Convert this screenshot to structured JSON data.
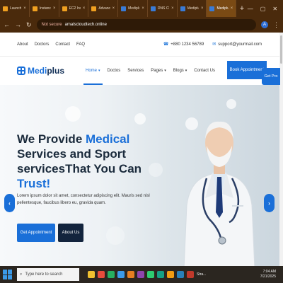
{
  "browser": {
    "tabs": [
      {
        "label": "Launch ..",
        "color": "#f0a020"
      },
      {
        "label": "Instanc..",
        "color": "#f0a020"
      },
      {
        "label": "EC2 Insta..",
        "color": "#f0a020"
      },
      {
        "label": "Advance..",
        "color": "#f0a020"
      },
      {
        "label": "Mediplus",
        "color": "#3a7bd5"
      },
      {
        "label": "DNS Che..",
        "color": "#3a7bd5"
      },
      {
        "label": "Mediplus",
        "color": "#3a7bd5"
      },
      {
        "label": "Mediplus",
        "color": "#3a7bd5",
        "active": true
      }
    ],
    "new_tab": "+",
    "controls": {
      "minimize": "—",
      "maximize": "▢",
      "close": "✕"
    },
    "address": {
      "not_secure": "Not secure",
      "url": "amalscloudtech.online"
    },
    "profile_initial": "A"
  },
  "topbar": {
    "links": [
      "About",
      "Doctors",
      "Contact",
      "FAQ"
    ],
    "phone": "+880 1234 56789",
    "email": "support@yourmail.com"
  },
  "nav": {
    "logo_prefix": "Medi",
    "logo_suffix": "plus",
    "items": [
      {
        "label": "Home",
        "caret": true,
        "active": true
      },
      {
        "label": "Doctos",
        "caret": false
      },
      {
        "label": "Services",
        "caret": false
      },
      {
        "label": "Pages",
        "caret": true
      },
      {
        "label": "Blogs",
        "caret": true
      },
      {
        "label": "Contact Us",
        "caret": false
      }
    ],
    "book_button": "Book Appointment",
    "get_pro": "Get Pro"
  },
  "hero": {
    "headline_1": "We Provide ",
    "headline_2": "Medical",
    "headline_3": " Services and Sport servicesThat You Can ",
    "headline_4": "Trust!",
    "paragraph": "Lorem ipsum dolor sit amet, consectetur adipiscing elit. Mauris sed nisl pellentesque, faucibus libero eu, gravida quam.",
    "primary_button": "Get Appointment",
    "secondary_button": "About Us",
    "prev_arrow": "‹",
    "next_arrow": "›"
  },
  "taskbar": {
    "search_placeholder": "Type here to search",
    "app_label": "Stra...",
    "time": "7:04 AM",
    "date": "7/21/2025",
    "icon_colors": [
      "#f0c030",
      "#e74c3c",
      "#27ae60",
      "#3b9ae8",
      "#e67e22",
      "#8e44ad",
      "#2ecc71",
      "#16a085",
      "#f39c12",
      "#2980b9",
      "#c0392b"
    ]
  },
  "colors": {
    "accent": "#1a6fd8",
    "dark": "#13243d"
  }
}
